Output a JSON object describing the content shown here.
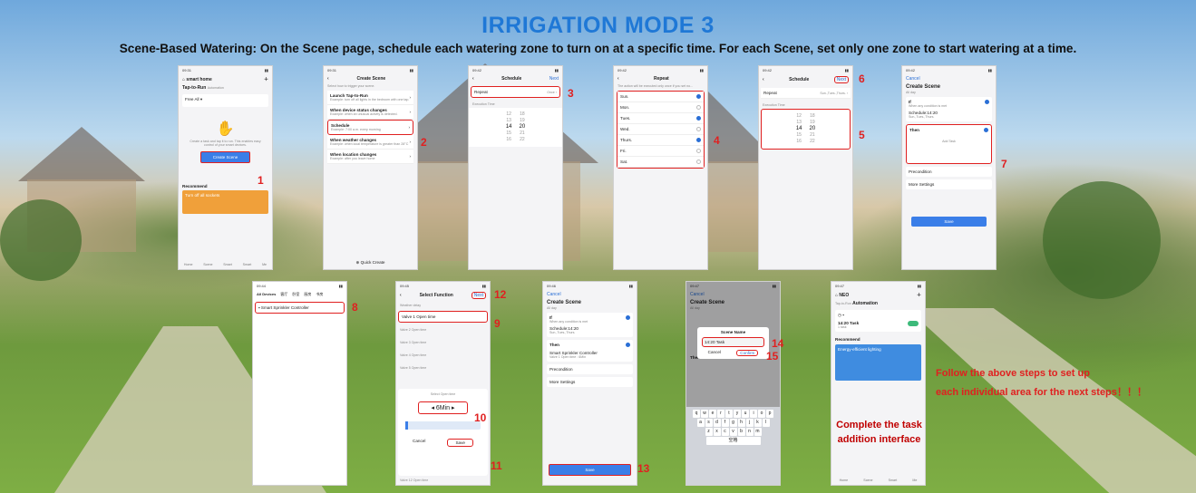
{
  "title": "IRRIGATION MODE 3",
  "subtitle": "Scene-Based Watering: On the Scene page, schedule each watering zone to turn on at a specific time. For each Scene, set only one zone to start watering at a time.",
  "colors": {
    "title": "#1f78d6",
    "accent": "#3a7ee8",
    "highlight": "#e02020"
  },
  "steps": [
    "1",
    "2",
    "3",
    "4",
    "5",
    "6",
    "7",
    "8",
    "9",
    "10",
    "11",
    "12",
    "13",
    "14",
    "15"
  ],
  "p1": {
    "time": "09:31",
    "home": "smart home",
    "tab1": "Tap-to-Run",
    "tab2": "Automation",
    "filter": "Free All",
    "empty": "Create a task and tap it to run. This enables easy control of your smart devices.",
    "btn": "Create Scene",
    "rec": "Recommend",
    "card": "Turn off all sockets",
    "nav": [
      "Home",
      "Scene",
      "Smart",
      "Smart",
      "Me"
    ]
  },
  "p2": {
    "time": "09:31",
    "title": "Create Scene",
    "hint": "Select how to trigger your scene.",
    "items": [
      {
        "t": "Launch Tap-to-Run",
        "d": "Example: turn off all lights in the bedroom with one tap."
      },
      {
        "t": "When device status changes",
        "d": "Example: when an unusual activity is detected."
      },
      {
        "t": "Schedule",
        "d": "Example: 7:00 a.m. every morning"
      },
      {
        "t": "When weather changes",
        "d": "Example: when local temperature is greater than 28°C"
      },
      {
        "t": "When location changes",
        "d": "Example: after you leave home"
      }
    ],
    "quick": "Quick Create"
  },
  "p3": {
    "time": "09:42",
    "title": "Schedule",
    "next": "Next",
    "repeat": "Repeat",
    "repeat_val": "Once",
    "exec": "Execution Time",
    "hours": [
      "12",
      "13",
      "14",
      "15",
      "16"
    ],
    "mins": [
      "18",
      "19",
      "20",
      "21",
      "22"
    ]
  },
  "p4": {
    "time": "09:42",
    "title": "Repeat",
    "hint": "The action will be executed only once if you set no...",
    "days": [
      "Sun.",
      "Mon.",
      "Tues.",
      "Wed.",
      "Thurs.",
      "Fri.",
      "Sat."
    ],
    "checked": [
      true,
      false,
      true,
      false,
      true,
      false,
      false
    ]
  },
  "p5": {
    "time": "09:42",
    "title": "Schedule",
    "next": "Next",
    "repeat": "Repeat",
    "repeat_val": "Sun.,Tues.,Thurs.",
    "exec": "Execution Time",
    "hours": [
      "12",
      "13",
      "14",
      "15",
      "16"
    ],
    "mins": [
      "18",
      "19",
      "20",
      "21",
      "22"
    ]
  },
  "p6": {
    "time": "09:42",
    "cancel": "Cancel",
    "title": "Create Scene",
    "sub": "All day",
    "if": "If",
    "if_hint": "When any condition is met",
    "cond": "Schedule:14:20",
    "cond_sub": "Sun.,Tues.,Thurs.",
    "then": "Then",
    "add_task": "Add Task",
    "pre": "Precondition",
    "more": "More Settings",
    "save": "Save"
  },
  "p7": {
    "time": "09:44",
    "tabs": [
      "All Devices",
      "客厅",
      "卧室",
      "厨房",
      "书房"
    ],
    "device": "Smart Sprinkler Controller"
  },
  "p8": {
    "time": "09:45",
    "title": "Select Function",
    "next": "Next",
    "items": [
      "Weather delay",
      "Valve 1 Open time",
      "Valve 2 Open time",
      "Valve 3 Open time",
      "Valve 4 Open time",
      "Valve 5 Open time"
    ],
    "last": "Valve 12 Open time",
    "modal_title": "Select Open time",
    "value": "6Min",
    "cancel": "Cancel",
    "save": "Save"
  },
  "p9": {
    "time": "09:46",
    "cancel": "Cancel",
    "title": "Create Scene",
    "sub": "All day",
    "if": "If",
    "if_hint": "When any condition is met",
    "cond": "Schedule:14:20",
    "cond_sub": "Sun.,Tues.,Thurs.",
    "then": "Then",
    "task": "Smart Sprinkler Controller",
    "task_sub": "Valve 1 Open time : 6Min",
    "pre": "Precondition",
    "more": "More Settings",
    "save": "Save"
  },
  "p10": {
    "time": "09:47",
    "cancel": "Cancel",
    "title": "Create Scene",
    "sub": "All day",
    "dialog_title": "Scene Name",
    "name": "14:20 Task",
    "cancel_btn": "Cancel",
    "confirm": "Confirm",
    "then": "Then",
    "keys1": [
      "q",
      "w",
      "e",
      "r",
      "t",
      "y",
      "u",
      "i",
      "o",
      "p"
    ],
    "keys2": [
      "a",
      "s",
      "d",
      "f",
      "g",
      "h",
      "j",
      "k",
      "l"
    ],
    "keys3": [
      "z",
      "x",
      "c",
      "v",
      "b",
      "n",
      "m"
    ],
    "space": "空格"
  },
  "p11": {
    "time": "09:47",
    "home": "NEO",
    "tab1": "Tap-to-Run",
    "tab2": "Automation",
    "task": "14:20 Task",
    "task_sub": "1 task",
    "rec": "Recommend",
    "card": "Energy-efficient lighting",
    "nav": [
      "Home",
      "Scene",
      "Smart",
      "Me"
    ]
  },
  "note1": "Follow the above steps to set up",
  "note2": "each individual area for the next steps！！！",
  "note3": "Complete the task",
  "note4": "addition interface"
}
